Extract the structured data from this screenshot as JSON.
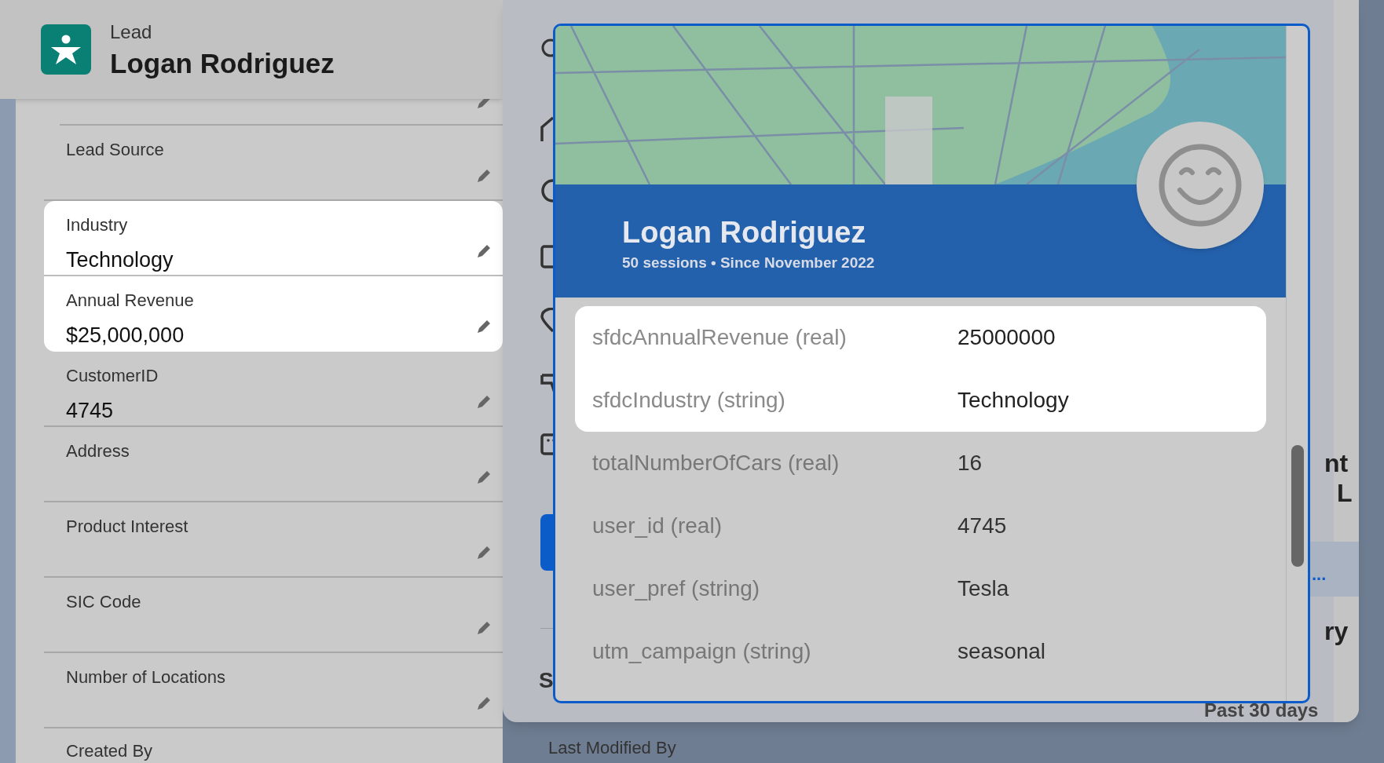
{
  "header": {
    "object_type": "Lead",
    "title": "Logan Rodriguez"
  },
  "fields": [
    {
      "label": "Lead Source",
      "highlighted": false
    },
    {
      "label": "Industry",
      "value": "Technology",
      "highlighted": true
    },
    {
      "label": "Annual Revenue",
      "value": "$25,000,000",
      "highlighted": true
    },
    {
      "label": "CustomerID",
      "value": "4745",
      "highlighted": false
    },
    {
      "label": "Address",
      "highlighted": false
    },
    {
      "label": "Product Interest",
      "highlighted": false
    },
    {
      "label": "SIC Code",
      "highlighted": false
    },
    {
      "label": "Number of Locations",
      "highlighted": false
    }
  ],
  "footer_labels": [
    "Created By",
    "Last Modified By"
  ],
  "sheet": {
    "nav_heading": "S",
    "right_fragments": [
      "nt",
      "L",
      "...",
      "ry"
    ],
    "range_label": "Past 30 days"
  },
  "profile_card": {
    "name": "Logan Rodriguez",
    "subtitle": "50 sessions • Since November 2022",
    "attributes": [
      {
        "name": "sfdcAnnualRevenue (real)",
        "value": "25000000",
        "highlighted": true
      },
      {
        "name": "sfdcIndustry (string)",
        "value": "Technology",
        "highlighted": true
      },
      {
        "name": "totalNumberOfCars (real)",
        "value": "16",
        "highlighted": false
      },
      {
        "name": "user_id (real)",
        "value": "4745",
        "highlighted": false
      },
      {
        "name": "user_pref (string)",
        "value": "Tesla",
        "highlighted": false
      },
      {
        "name": "utm_campaign (string)",
        "value": "seasonal",
        "highlighted": false
      }
    ]
  }
}
